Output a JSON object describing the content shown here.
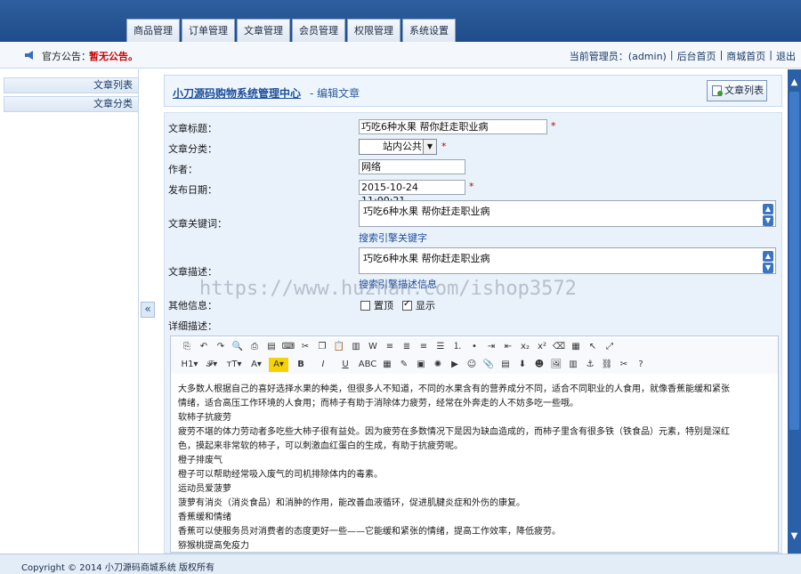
{
  "topnav": [
    "商品管理",
    "订单管理",
    "文章管理",
    "会员管理",
    "权限管理",
    "系统设置"
  ],
  "notice": {
    "label": "官方公告：",
    "text": "暂无公告。"
  },
  "userbar": {
    "admin_text": "当前管理员：(admin)",
    "links": [
      "后台首页",
      "商城首页",
      "退出"
    ],
    "separator": "|"
  },
  "sidebar": {
    "items": [
      "文章列表",
      "文章分类"
    ],
    "collapse": "«"
  },
  "header": {
    "title": "小刀源码购物系统管理中心",
    "subtitle": "- 编辑文章",
    "list_button": "文章列表"
  },
  "form": {
    "title_label": "文章标题：",
    "title_value": "巧吃6种水果 帮你赶走职业病",
    "category_label": "文章分类：",
    "category_value": "站内公共",
    "author_label": "作者：",
    "author_value": "网络",
    "date_label": "发布日期：",
    "date_value": "2015-10-24 11:00:21",
    "keywords_label": "文章关键词：",
    "keywords_value": "巧吃6种水果 帮你赶走职业病",
    "keywords_hint": "搜索引擎关键字",
    "desc_label": "文章描述：",
    "desc_value": "巧吃6种水果 帮你赶走职业病",
    "desc_hint": "搜索引擎描述信息",
    "other_label": "其他信息：",
    "top_label": "置顶",
    "top_checked": false,
    "show_label": "显示",
    "show_checked": true,
    "detail_label": "详细描述：",
    "required_mark": "*"
  },
  "toolbar": {
    "row1_icons": [
      "source-icon",
      "undo-icon",
      "redo-icon",
      "preview-icon",
      "print-icon",
      "template-icon",
      "code-icon",
      "cut-icon",
      "copy-icon",
      "paste-icon",
      "paste-text-icon",
      "paste-word-icon",
      "align-left-icon",
      "align-center-icon",
      "align-right-icon",
      "align-justify-icon",
      "ordered-list-icon",
      "unordered-list-icon",
      "indent-icon",
      "outdent-icon",
      "subscript-icon",
      "superscript-icon",
      "clear-format-icon",
      "select-all-icon",
      "cursor-icon",
      "fullscreen-icon"
    ],
    "row2_labels": [
      "H1▾",
      "𝓕▾",
      "тT▾",
      "A▾",
      "A▾",
      "B",
      "I",
      "U",
      "ABC"
    ]
  },
  "editor": {
    "lines": [
      "大多数人根据自己的喜好选择水果的种类，但很多人不知道，不同的水果含有的营养成分不同，适合不同职业的人食用，就像香蕉能缓和紧张",
      "情绪，适合高压工作环境的人食用；而柿子有助于消除体力疲劳，经常在外奔走的人不妨多吃一些哦。",
      "软柿子抗疲劳",
      "疲劳不堪的体力劳动者多吃些大柿子很有益处。因为疲劳在多数情况下是因为缺血造成的，而柿子里含有很多铁（铁食品）元素，特别是深红",
      "色，摸起来非常软的柿子，可以刺激血红蛋白的生成，有助于抗疲劳呢。",
      "橙子排废气",
      "橙子可以帮助经常吸入废气的司机排除体内的毒素。",
      "运动员爱菠萝",
      "菠萝有消炎（消炎食品）和消肿的作用，能改善血液循环，促进肌腱炎症和外伤的康复。",
      "香蕉缓和情绪",
      "香蕉可以使服务员对消费者的态度更好一些——它能缓和紧张的情绪，提高工作效率，降低疲劳。",
      "猕猴桃提高免疫力"
    ]
  },
  "watermark": "https://www.huzhan.com/ishop3572",
  "footer": {
    "copyright": "Copyright © 2014 小刀源码商城系统 版权所有"
  }
}
